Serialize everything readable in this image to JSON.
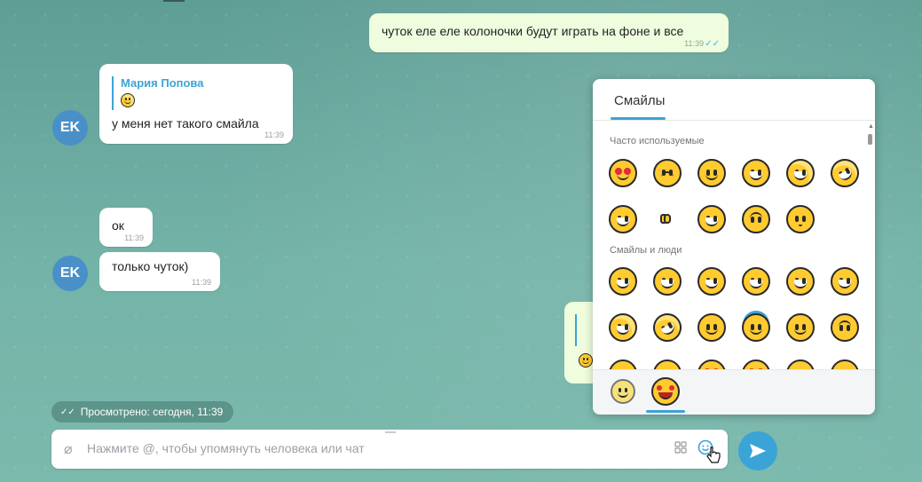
{
  "messages": {
    "m1": {
      "text": "чуток еле еле колоночки будут играть на фоне и все",
      "time": "11:39"
    },
    "m2": {
      "reply_name": "Мария Попова",
      "text": "у меня нет такого смайла",
      "time": "11:39"
    },
    "m3": {
      "text": "ок",
      "time": "11:39"
    },
    "m4": {
      "text": "только чуток)",
      "time": "11:39"
    },
    "avatar_initials": "EK"
  },
  "status": {
    "viewed_text": "Просмотрено: сегодня, 11:39"
  },
  "composer": {
    "placeholder": "Нажмите @, чтобы упомянуть человека или чат"
  },
  "emoji_panel": {
    "tab_label": "Смайлы",
    "section_frequent": "Часто используемые",
    "section_people": "Смайлы и люди"
  },
  "colors": {
    "accent": "#3aa4d6",
    "avatar": "#4a90c8",
    "outgoing": "#effdde",
    "emoji": "#ffcb2f"
  }
}
